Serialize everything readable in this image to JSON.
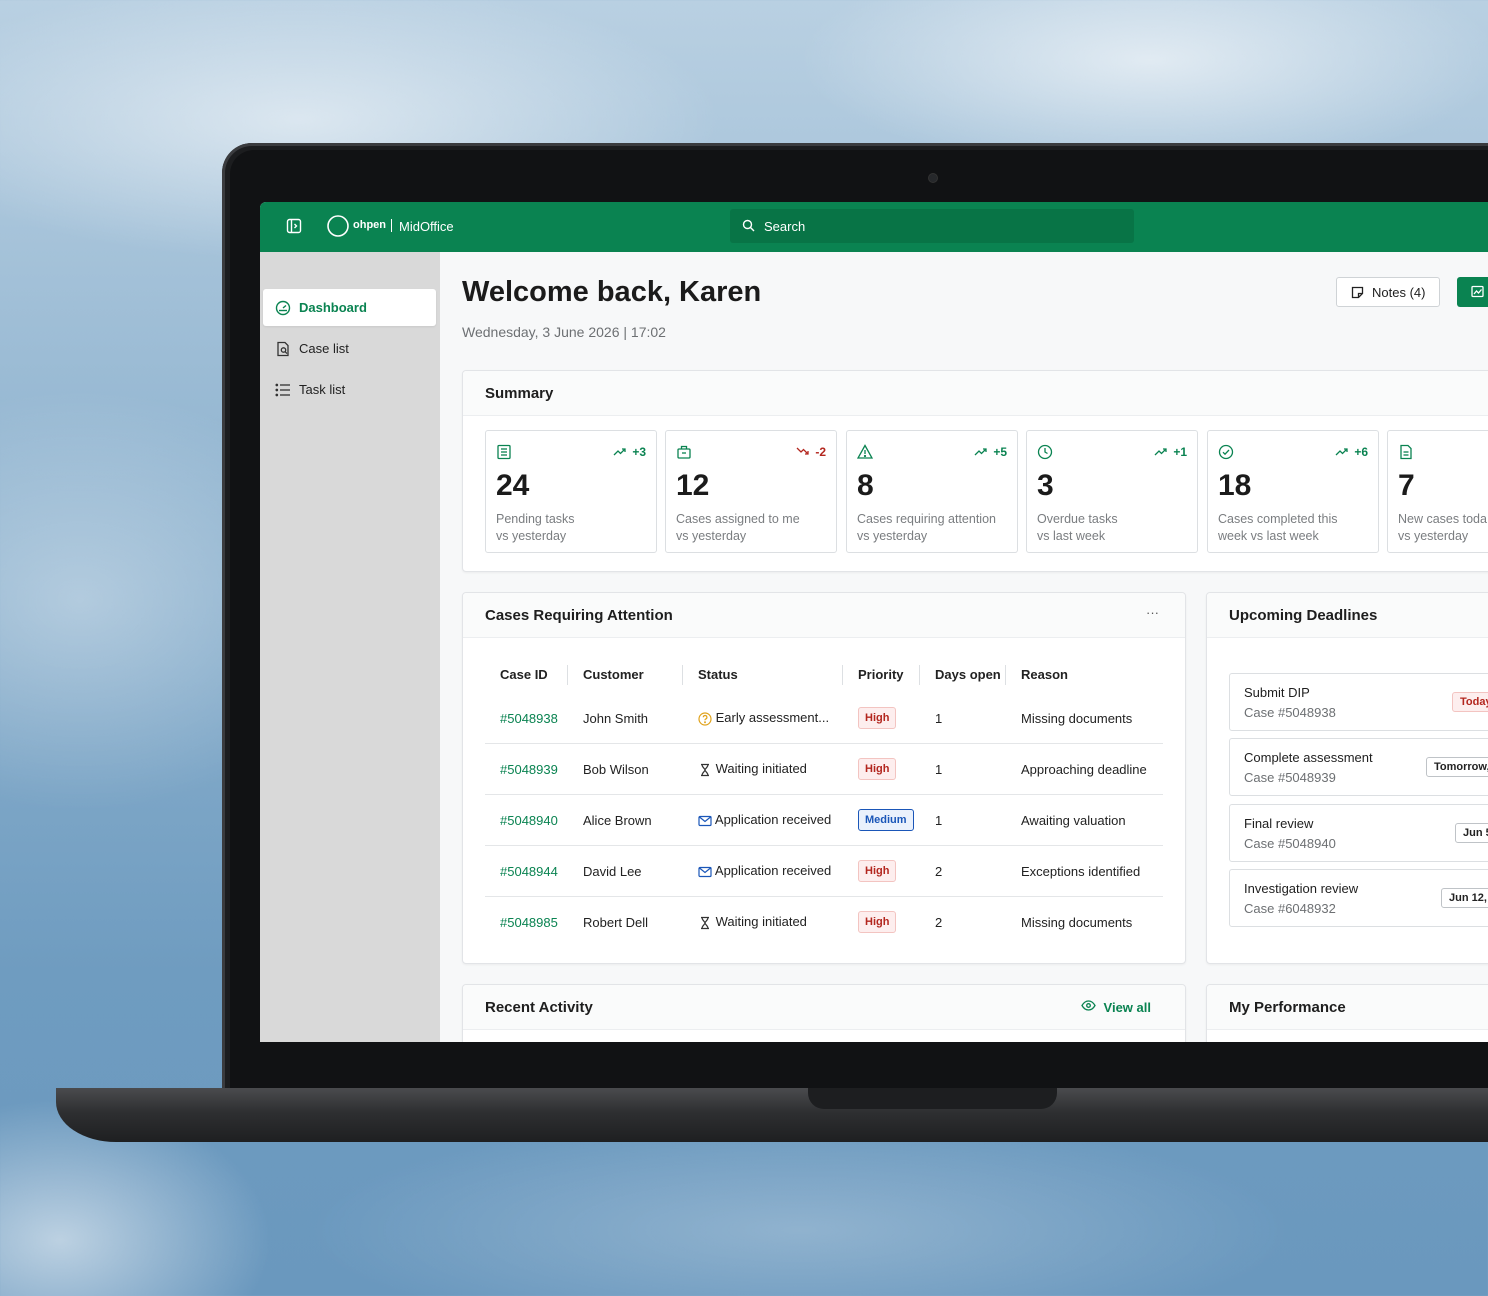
{
  "header": {
    "brand": "ohpen",
    "product": "MidOffice",
    "search_placeholder": "Search"
  },
  "sidebar": {
    "items": [
      {
        "label": "Dashboard",
        "icon": "gauge-icon",
        "active": true
      },
      {
        "label": "Case list",
        "icon": "document-search-icon",
        "active": false
      },
      {
        "label": "Task list",
        "icon": "list-icon",
        "active": false
      }
    ]
  },
  "page": {
    "title": "Welcome back, Karen",
    "datetime": "Wednesday, 3 June 2026 | 17:02",
    "notes_label": "Notes (4)"
  },
  "summary": {
    "title": "Summary",
    "stats": [
      {
        "value": "24",
        "label": "Pending tasks\nvs yesterday",
        "trend": "+3",
        "direction": "up",
        "icon": "list-doc-icon"
      },
      {
        "value": "12",
        "label": "Cases assigned to me\nvs yesterday",
        "trend": "-2",
        "direction": "down",
        "icon": "briefcase-icon"
      },
      {
        "value": "8",
        "label": "Cases requiring attention\nvs yesterday",
        "trend": "+5",
        "direction": "up",
        "icon": "warning-icon"
      },
      {
        "value": "3",
        "label": "Overdue tasks\nvs last week",
        "trend": "+1",
        "direction": "up",
        "icon": "clock-icon"
      },
      {
        "value": "18",
        "label": "Cases completed this\nweek vs last week",
        "trend": "+6",
        "direction": "up",
        "icon": "check-circle-icon"
      },
      {
        "value": "7",
        "label": "New cases toda\nvs yesterday",
        "trend": "",
        "direction": "up",
        "icon": "file-icon"
      }
    ]
  },
  "attention": {
    "title": "Cases Requiring Attention",
    "menu": "···",
    "columns": [
      "Case ID",
      "Customer",
      "Status",
      "Priority",
      "Days open",
      "Reason"
    ],
    "rows": [
      {
        "id": "#5048938",
        "customer": "John Smith",
        "status": "Early assessment...",
        "status_icon": "help-circle-icon",
        "priority": "High",
        "days": "1",
        "reason": "Missing documents"
      },
      {
        "id": "#5048939",
        "customer": "Bob Wilson",
        "status": "Waiting initiated",
        "status_icon": "hourglass-icon",
        "priority": "High",
        "days": "1",
        "reason": "Approaching deadline"
      },
      {
        "id": "#5048940",
        "customer": "Alice Brown",
        "status": "Application received",
        "status_icon": "mail-icon",
        "priority": "Medium",
        "days": "1",
        "reason": "Awaiting valuation"
      },
      {
        "id": "#5048944",
        "customer": "David Lee",
        "status": "Application received",
        "status_icon": "mail-icon",
        "priority": "High",
        "days": "2",
        "reason": "Exceptions identified"
      },
      {
        "id": "#5048985",
        "customer": "Robert Dell",
        "status": "Waiting initiated",
        "status_icon": "hourglass-icon",
        "priority": "High",
        "days": "2",
        "reason": "Missing documents"
      }
    ]
  },
  "deadlines": {
    "title": "Upcoming Deadlines",
    "items": [
      {
        "title": "Submit DIP",
        "case": "Case #5048938",
        "when": "Today",
        "urgent": true
      },
      {
        "title": "Complete assessment",
        "case": "Case #5048939",
        "when": "Tomorrow,",
        "urgent": false
      },
      {
        "title": "Final review",
        "case": "Case #5048940",
        "when": "Jun 5",
        "urgent": false
      },
      {
        "title": "Investigation review",
        "case": "Case #6048932",
        "when": "Jun 12,",
        "urgent": false
      }
    ]
  },
  "activity": {
    "title": "Recent Activity",
    "view_all": "View all"
  },
  "performance": {
    "title": "My Performance"
  },
  "colors": {
    "brand": "#0a8351",
    "danger": "#b3261e",
    "info": "#1a56b8"
  }
}
